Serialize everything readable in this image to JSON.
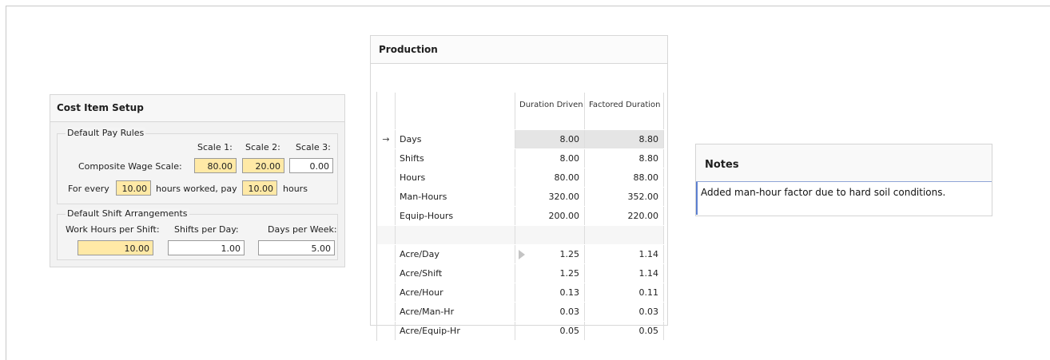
{
  "cost_item_setup": {
    "title": "Cost Item Setup",
    "pay_rules": {
      "caption": "Default Pay Rules",
      "scale_headers": [
        "Scale 1:",
        "Scale 2:",
        "Scale 3:"
      ],
      "composite_label": "Composite Wage Scale:",
      "scale_values": [
        "80.00",
        "20.00",
        "0.00"
      ],
      "for_every_label": "For every",
      "for_every_value": "10.00",
      "hours_worked_label": "hours worked, pay",
      "pay_value": "10.00",
      "hours_label": "hours"
    },
    "shift": {
      "caption": "Default Shift Arrangements",
      "hours_per_shift_label": "Work Hours per Shift:",
      "shifts_per_day_label": "Shifts per Day:",
      "days_per_week_label": "Days per Week:",
      "hours_per_shift": "10.00",
      "shifts_per_day": "1.00",
      "days_per_week": "5.00"
    },
    "highlight_color": "#ffe9a6"
  },
  "production": {
    "title": "Production",
    "col1_header": "Duration Driven Resources",
    "col2_header": "Factored Duration Driven Resources",
    "current_row_indicator": "→",
    "rows": [
      {
        "name": "Days",
        "v1": "8.00",
        "v2": "8.80"
      },
      {
        "name": "Shifts",
        "v1": "8.00",
        "v2": "8.80"
      },
      {
        "name": "Hours",
        "v1": "80.00",
        "v2": "88.00"
      },
      {
        "name": "Man-Hours",
        "v1": "320.00",
        "v2": "352.00"
      },
      {
        "name": "Equip-Hours",
        "v1": "200.00",
        "v2": "220.00"
      },
      {
        "name": "Acre/Day",
        "v1": "1.25",
        "v2": "1.14"
      },
      {
        "name": "Acre/Shift",
        "v1": "1.25",
        "v2": "1.14"
      },
      {
        "name": "Acre/Hour",
        "v1": "0.13",
        "v2": "0.11"
      },
      {
        "name": "Acre/Man-Hr",
        "v1": "0.03",
        "v2": "0.03"
      },
      {
        "name": "Acre/Equip-Hr",
        "v1": "0.05",
        "v2": "0.05"
      }
    ]
  },
  "notes": {
    "title": "Notes",
    "text": "Added man-hour factor due to hard soil conditions."
  }
}
